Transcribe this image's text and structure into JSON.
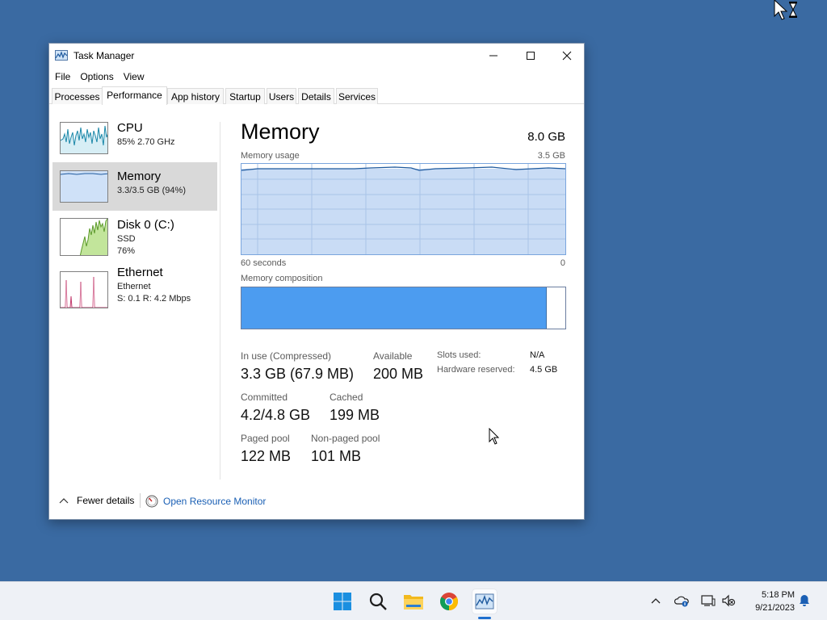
{
  "window": {
    "title": "Task Manager",
    "menu": [
      "File",
      "Options",
      "View"
    ],
    "tabs": [
      "Processes",
      "Performance",
      "App history",
      "Startup",
      "Users",
      "Details",
      "Services"
    ],
    "active_tab": "Performance"
  },
  "sidebar": {
    "items": [
      {
        "title": "CPU",
        "line1": "85%  2.70 GHz",
        "line2": ""
      },
      {
        "title": "Memory",
        "line1": "3.3/3.5 GB (94%)",
        "line2": ""
      },
      {
        "title": "Disk 0 (C:)",
        "line1": "SSD",
        "line2": "76%"
      },
      {
        "title": "Ethernet",
        "line1": "Ethernet",
        "line2": "S: 0.1  R: 4.2 Mbps"
      }
    ],
    "selected": "Memory"
  },
  "memory": {
    "title": "Memory",
    "total": "8.0 GB",
    "usage_label": "Memory usage",
    "usage_max": "3.5 GB",
    "time_left": "60 seconds",
    "time_right": "0",
    "composition_label": "Memory composition",
    "composition_in_use_fraction": 0.943,
    "stats": {
      "in_use_label": "In use (Compressed)",
      "in_use_value": "3.3 GB (67.9 MB)",
      "available_label": "Available",
      "available_value": "200 MB",
      "committed_label": "Committed",
      "committed_value": "4.2/4.8 GB",
      "cached_label": "Cached",
      "cached_value": "199 MB",
      "paged_label": "Paged pool",
      "paged_value": "122 MB",
      "nonpaged_label": "Non-paged pool",
      "nonpaged_value": "101 MB",
      "slots_label": "Slots used:",
      "slots_value": "N/A",
      "hw_reserved_label": "Hardware reserved:",
      "hw_reserved_value": "4.5 GB"
    }
  },
  "footer": {
    "fewer_details": "Fewer details",
    "open_resource_monitor": "Open Resource Monitor"
  },
  "taskbar": {
    "apps": [
      "start-icon",
      "search-icon",
      "file-explorer-icon",
      "chrome-icon",
      "task-manager-icon"
    ],
    "active_app": "task-manager-icon",
    "tray": [
      "chevron-up-icon",
      "onedrive-icon",
      "network-icon",
      "volume-muted-icon",
      "notification-bell-icon"
    ],
    "time": "5:18 PM",
    "date": "9/21/2023"
  },
  "colors": {
    "desktop": "#3a6aa2",
    "memory_graph_fill": "#c9dcf5",
    "memory_graph_line": "#1f5a9e",
    "composition_fill": "#4c9cf0",
    "cpu_line": "#1a87a8",
    "disk_fill": "#b7e08a",
    "ethernet_line": "#c23b6d",
    "link_blue": "#1a5fb4"
  }
}
